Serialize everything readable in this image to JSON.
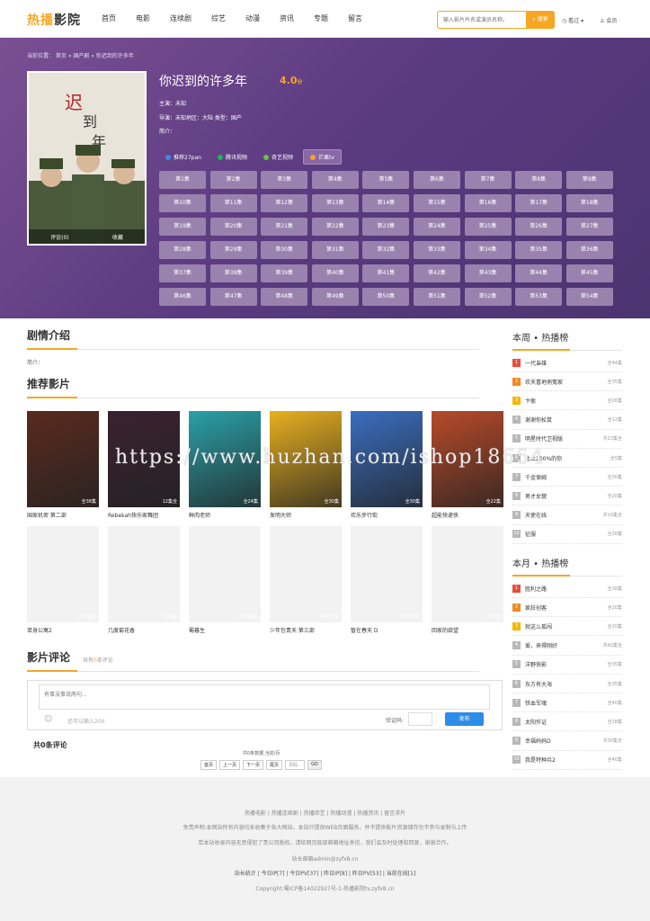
{
  "header": {
    "logo_a": "热播",
    "logo_b": "影院",
    "nav": [
      "首页",
      "电影",
      "连续剧",
      "综艺",
      "动漫",
      "资讯",
      "专题",
      "留言"
    ],
    "search_placeholder": "输入影片片名或演员名称。",
    "search_button": "搜索",
    "history": "看过",
    "member": "会员"
  },
  "banner": {
    "breadcrumb": "当前位置： 首页 » 国产剧 » 你迟到的许多年",
    "title": "你迟到的许多年",
    "score": "4.0",
    "score_unit": "分",
    "cast": "主演：未知",
    "director": "导演：未知地区：大陆  类型：国产",
    "intro": "简介：",
    "comments_link": "评论(0)",
    "fav_link": "收藏",
    "sources": [
      {
        "label": "推荐27pan",
        "color": "#3b8be8"
      },
      {
        "label": "腾讯视频",
        "color": "#20b35a"
      },
      {
        "label": "奇艺视频",
        "color": "#6dbf3c"
      },
      {
        "label": "芒果tv",
        "color": "#f5a623"
      }
    ],
    "episodes": [
      "第1集",
      "第2集",
      "第3集",
      "第4集",
      "第5集",
      "第6集",
      "第7集",
      "第8集",
      "第9集",
      "第10集",
      "第11集",
      "第12集",
      "第13集",
      "第14集",
      "第15集",
      "第16集",
      "第17集",
      "第18集",
      "第19集",
      "第20集",
      "第21集",
      "第22集",
      "第23集",
      "第24集",
      "第25集",
      "第26集",
      "第27集",
      "第28集",
      "第29集",
      "第30集",
      "第31集",
      "第32集",
      "第33集",
      "第34集",
      "第35集",
      "第36集",
      "第37集",
      "第38集",
      "第39集",
      "第40集",
      "第41集",
      "第42集",
      "第43集",
      "第44集",
      "第45集",
      "第46集",
      "第47集",
      "第48集",
      "第49集",
      "第50集",
      "第51集",
      "第52集",
      "第53集",
      "第54集"
    ]
  },
  "plot": {
    "title": "剧情介绍",
    "intro": "简介："
  },
  "recommend": {
    "title": "推荐影片",
    "row1": [
      {
        "name": "国家机密 第二部",
        "badge": "全38集",
        "color": "#5a2a1e"
      },
      {
        "name": "Rebekah快乐家舞团",
        "badge": "12集全",
        "color": "#3a2230"
      },
      {
        "name": "鲜肉老师",
        "badge": "全24集",
        "color": "#2aa0a8"
      },
      {
        "name": "发明大师",
        "badge": "全30集",
        "color": "#e8b020"
      },
      {
        "name": "欢乐步行街",
        "badge": "全30集",
        "color": "#3a6ec0"
      },
      {
        "name": "超能快递侠",
        "badge": "全22集",
        "color": "#b84a2a"
      }
    ],
    "row2": [
      {
        "name": "单身公寓2",
        "badge": "共20集全"
      },
      {
        "name": "几度菊花香",
        "badge": "全30集"
      },
      {
        "name": "蜀暮生",
        "badge": "共20集全"
      },
      {
        "name": "少年包青天 第三部",
        "badge": "共40集全"
      },
      {
        "name": "暂在春天 D",
        "badge": "共42集全"
      },
      {
        "name": "回家的欲望",
        "badge": "全30集"
      }
    ]
  },
  "comments": {
    "title": "影片评论",
    "count_pre": "共有",
    "count_num": "0",
    "count_post": "条评论",
    "placeholder": "有事没事说两句...",
    "remain": "还可以输入200",
    "verify_label": "验证码:",
    "publish": "发布",
    "total": "共0条评论",
    "page_info": "共0条数据,当前/页",
    "pager": [
      "首页",
      "上一页",
      "下一页",
      "尾页"
    ],
    "page_input": "页码",
    "go": "GO"
  },
  "week_rank": {
    "title": "本周 • 热播榜",
    "items": [
      {
        "name": "一代枭雄",
        "count": "全44集"
      },
      {
        "name": "欢天喜地俏冤家",
        "count": "全35集"
      },
      {
        "name": "卞衙",
        "count": "全26集"
      },
      {
        "name": "谢谢你松鼠",
        "count": "全12集"
      },
      {
        "name": "明星时代卫视版",
        "count": "共23集全"
      },
      {
        "name": "比上200%的你",
        "count": "全5集"
      },
      {
        "name": "千金保姆",
        "count": "全30集"
      },
      {
        "name": "男才女貌",
        "count": "全20集"
      },
      {
        "name": "天使在线",
        "count": "共19集全"
      },
      {
        "name": "征服",
        "count": "全20集"
      }
    ]
  },
  "month_rank": {
    "title": "本月 • 热播榜",
    "items": [
      {
        "name": "胜利之路",
        "count": "全38集"
      },
      {
        "name": "疯狂创客",
        "count": "全20集"
      },
      {
        "name": "就这么孤闯",
        "count": "全20集"
      },
      {
        "name": "爱，来得刚好",
        "count": "共60集全"
      },
      {
        "name": "洋野侠影",
        "count": "全35集"
      },
      {
        "name": "东方有大海",
        "count": "全35集"
      },
      {
        "name": "铁血军魂",
        "count": "全40集"
      },
      {
        "name": "太阳作证",
        "count": "全28集"
      },
      {
        "name": "幸福妈妈D",
        "count": "共30集全"
      },
      {
        "name": "我是特种兵2",
        "count": "全40集"
      }
    ]
  },
  "rank_colors": [
    "#e84c3d",
    "#f08a24",
    "#f5b700",
    "#b8b8b8"
  ],
  "footer": {
    "links": "热播电影  |  热播连续剧  |  热播综艺  |  热播动漫  |  热播资讯  |  留言求片",
    "disclaimer1": "免责声明:本网站所有内容均系收集于各大网站，本站只提供WEB页面服务，并不提供影片资源储存也不参与录制与上传",
    "disclaimer2": "若本站收录内容无意侵犯了贵公司版权，请给网页底部邮箱地址来信，我们会及时处理和回复，谢谢合作。",
    "email": "站长邮箱admin@zyfx8.cn",
    "stats": "站长统计 | 今日IP[7] | 今日PV[37] | 昨日IP[8] | 昨日PV[53] | 当前在线[1]",
    "copyright": "Copyright:蜀ICP备14022927号-1-热播影院tv.zyfx8.cn"
  },
  "watermark": "https://www.huzhan.com/ishop18654"
}
